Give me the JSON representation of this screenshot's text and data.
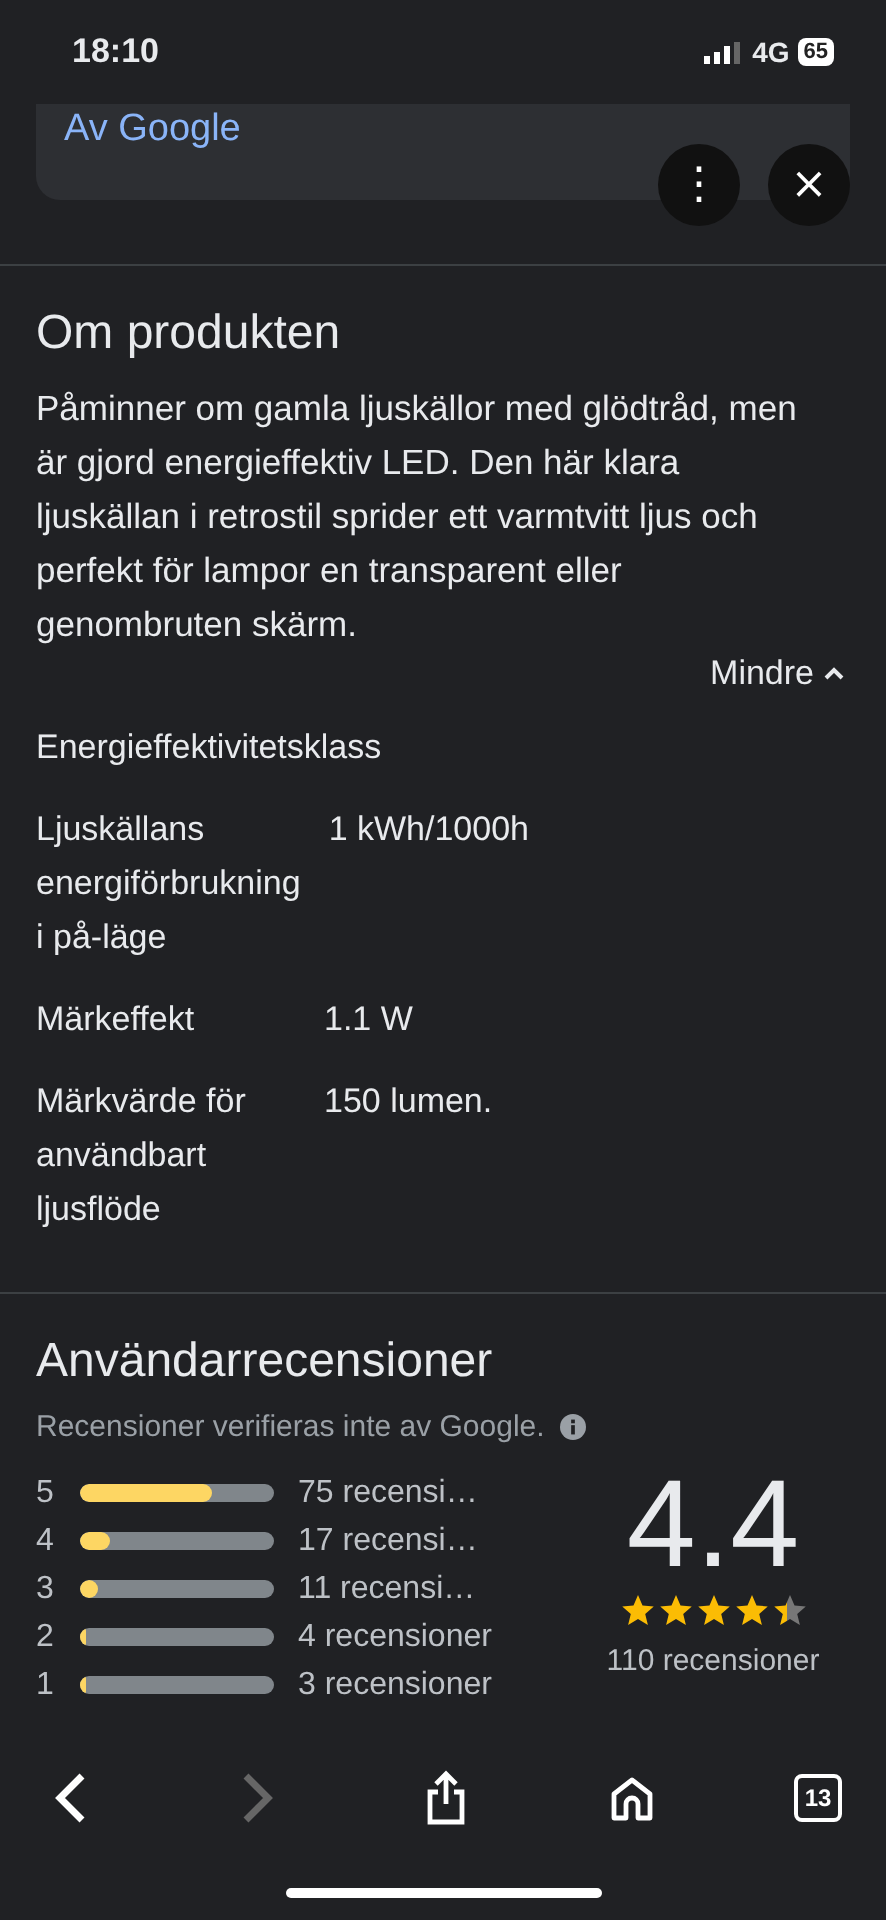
{
  "status_bar": {
    "time": "18:10",
    "network": "4G",
    "battery": "65"
  },
  "source_card": {
    "link": "Av Google",
    "more_button": "⋮",
    "close_button": "×"
  },
  "about": {
    "title": "Om produkten",
    "description": "Påminner om gamla ljuskällor med glödtråd, men är gjord energieffektiv LED. Den här klara ljuskällan i retrostil sprider ett varmtvitt ljus och perfekt för lampor en transparent eller genombruten skärm.",
    "toggle": "Mindre",
    "specs": [
      {
        "label": "Energieffektivitetsklass"
      },
      {
        "label": "Ljuskällans energiförbrukning i på-läge",
        "value": "1 kWh/1000h"
      },
      {
        "label": "Märkeffekt",
        "value": "1.1 W"
      },
      {
        "label": "Märkvärde för användbart ljusflöde",
        "value": "150 lumen."
      }
    ]
  },
  "reviews": {
    "title": "Användarrecensioner",
    "note": "Recensioner verifieras inte av Google.",
    "rows": [
      {
        "star": "5",
        "level": 0.68,
        "count": "75 recensi…"
      },
      {
        "star": "4",
        "level": 0.15,
        "count": "17 recensi…"
      },
      {
        "star": "3",
        "level": 0.09,
        "count": "11 recensi…"
      },
      {
        "star": "2",
        "level": 0.03,
        "count": "4 recensioner"
      },
      {
        "star": "1",
        "level": 0.03,
        "count": "3 recensioner"
      }
    ],
    "score": "4.4",
    "stars": 4.4,
    "total": "110 recensioner"
  },
  "toolbar": {
    "tabs_count": "13",
    "forward_disabled": true
  }
}
